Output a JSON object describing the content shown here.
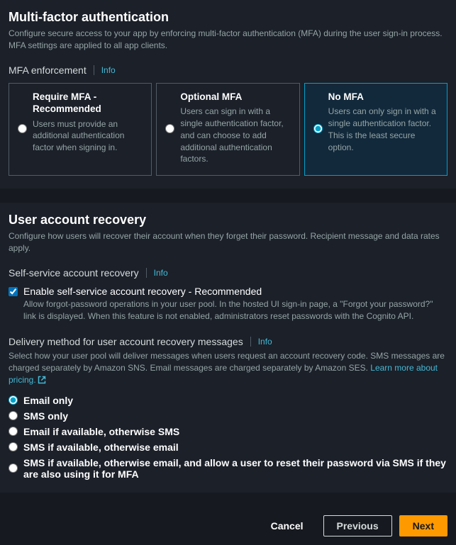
{
  "mfa": {
    "heading": "Multi-factor authentication",
    "subtitle": "Configure secure access to your app by enforcing multi-factor authentication (MFA) during the user sign-in process. MFA settings are applied to all app clients.",
    "enforcement_label": "MFA enforcement",
    "info": "Info",
    "tiles": [
      {
        "title": "Require MFA - Recommended",
        "desc": "Users must provide an additional authentication factor when signing in."
      },
      {
        "title": "Optional MFA",
        "desc": "Users can sign in with a single authentication factor, and can choose to add additional authentication factors."
      },
      {
        "title": "No MFA",
        "desc": "Users can only sign in with a single authentication factor. This is the least secure option."
      }
    ]
  },
  "recovery": {
    "heading": "User account recovery",
    "subtitle": "Configure how users will recover their account when they forget their password. Recipient message and data rates apply.",
    "self_service_label": "Self-service account recovery",
    "info": "Info",
    "checkbox_title": "Enable self-service account recovery - Recommended",
    "checkbox_desc": "Allow forgot-password operations in your user pool. In the hosted UI sign-in page, a \"Forgot your password?\" link is displayed. When this feature is not enabled, administrators reset passwords with the Cognito API.",
    "delivery_label": "Delivery method for user account recovery messages",
    "delivery_desc_pre": "Select how your user pool will deliver messages when users request an account recovery code. SMS messages are charged separately by Amazon SNS. Email messages are charged separately by Amazon SES. ",
    "learn_more": "Learn more about pricing.",
    "options": [
      "Email only",
      "SMS only",
      "Email if available, otherwise SMS",
      "SMS if available, otherwise email",
      "SMS if available, otherwise email, and allow a user to reset their password via SMS if they are also using it for MFA"
    ]
  },
  "footer": {
    "cancel": "Cancel",
    "previous": "Previous",
    "next": "Next"
  }
}
